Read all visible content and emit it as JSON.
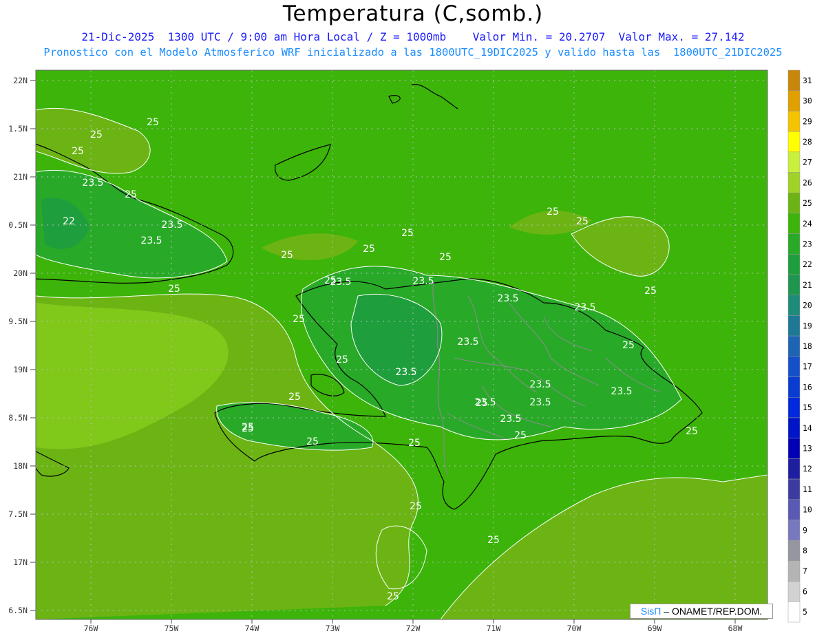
{
  "header": {
    "title": "Temperatura (C,somb.)",
    "subtitle_line1": "21-Dic-2025  1300 UTC / 9:00 am Hora Local / Z = 1000mb    Valor Min. = 20.2707  Valor Max. = 27.142",
    "subtitle_line2": "Pronostico con el Modelo Atmosferico WRF inicializado a las 1800UTC_19DIC2025 y valido hasta las  1800UTC_21DIC2025"
  },
  "stats": {
    "min_value": 20.2707,
    "max_value": 27.142,
    "units": "C"
  },
  "axes": {
    "lat_labels": [
      "22N",
      "1.5N",
      "21N",
      "0.5N",
      "20N",
      "9.5N",
      "19N",
      "8.5N",
      "18N",
      "7.5N",
      "17N",
      "6.5N"
    ],
    "lon_labels": [
      "76W",
      "75W",
      "74W",
      "73W",
      "72W",
      "71W",
      "70W",
      "69W",
      "68W"
    ]
  },
  "colorbar": {
    "labels": [
      "31",
      "30",
      "29",
      "28",
      "27",
      "26",
      "25",
      "24",
      "23",
      "22",
      "21",
      "20",
      "19",
      "18",
      "17",
      "16",
      "15",
      "14",
      "13",
      "12",
      "11",
      "10",
      "9",
      "8",
      "7",
      "6",
      "5"
    ],
    "colors": [
      "#c8860a",
      "#e0a000",
      "#f5c400",
      "#ffff00",
      "#c8f03c",
      "#a0d228",
      "#6cb414",
      "#3cb40a",
      "#28aa28",
      "#1e9e3c",
      "#1e9650",
      "#1e8c78",
      "#1e7896",
      "#1e64b4",
      "#1450c8",
      "#0a3cd2",
      "#0028dc",
      "#0014c8",
      "#0000b4",
      "#1e1ea0",
      "#3c3ca0",
      "#5a5ab4",
      "#7878be",
      "#9696a0",
      "#b4b4b4",
      "#d2d2d2",
      "#ffffff"
    ]
  },
  "contour_labels": [
    "25",
    "25",
    "25",
    "23.5",
    "25",
    "23.5",
    "23.5",
    "22",
    "25",
    "25",
    "25",
    "25",
    "25",
    "25",
    "25",
    "23.5",
    "23.5",
    "23.5",
    "23.5",
    "25",
    "25",
    "25",
    "23.5",
    "23.5",
    "25",
    "25",
    "23.5",
    "23.5",
    "23.5",
    "23.5",
    "23.5",
    "25",
    "25",
    "25",
    "25",
    "25",
    "25",
    "25",
    "25",
    "25",
    "25",
    "25"
  ],
  "credit": {
    "brand": "SisΠ",
    "text": "– ONAMET/REP.DOM."
  }
}
